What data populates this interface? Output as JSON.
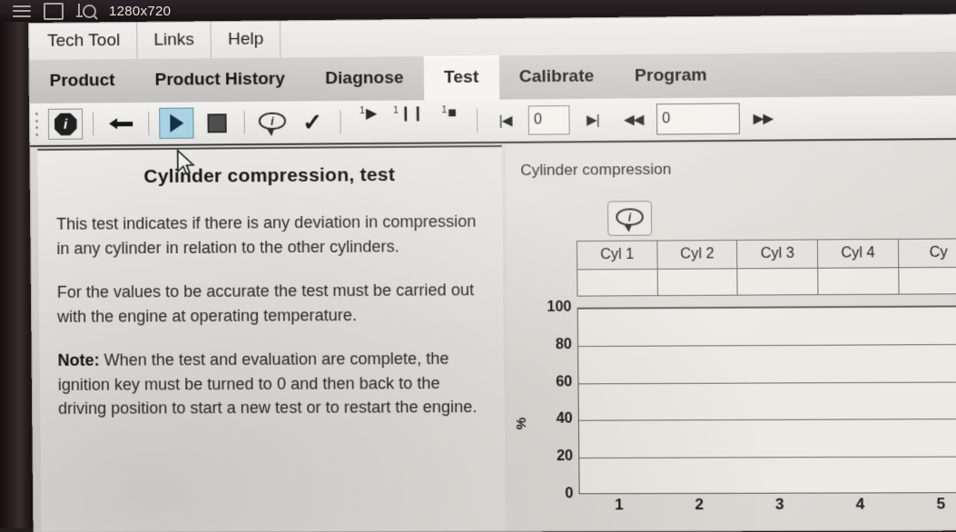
{
  "window": {
    "resolution": "1280x720",
    "icons": [
      "hamburger-menu-icon",
      "window-square-icon",
      "measure-magnifier-icon"
    ]
  },
  "menubar": {
    "items": [
      {
        "label": "Tech Tool"
      },
      {
        "label": "Links"
      },
      {
        "label": "Help"
      }
    ]
  },
  "tabs": [
    {
      "label": "Product",
      "active": false
    },
    {
      "label": "Product History",
      "active": false
    },
    {
      "label": "Diagnose",
      "active": false
    },
    {
      "label": "Test",
      "active": true
    },
    {
      "label": "Calibrate",
      "active": false
    },
    {
      "label": "Program",
      "active": false
    }
  ],
  "toolbar": {
    "info_button": "i",
    "back_button": "back-arrow",
    "play_button": "play",
    "stop_button": "stop",
    "info_balloon_button": "i",
    "confirm_button": "✓",
    "step_play": {
      "sup": "1",
      "glyph": "▶"
    },
    "step_pause": {
      "sup": "1",
      "glyph": "❙❙"
    },
    "step_stop": {
      "sup": "1",
      "glyph": "■"
    },
    "first_button": "|◀",
    "page_input_value": "0",
    "next_button": "▶|",
    "rewind_button": "◀◀",
    "position_input_value": "0",
    "forward_button": "▶▶"
  },
  "document": {
    "title": "Cylinder compression, test",
    "paragraphs": [
      "This test indicates if there is any deviation in compression in any cylinder in relation to the other cylinders.",
      "For the values to be accurate the test must be carried out with the engine at operating temperature."
    ],
    "note_label": "Note:",
    "note_text": " When the test and evaluation are complete, the ignition key must be turned to 0 and then back to the driving position to start a new test or to restart the engine."
  },
  "chart_data": {
    "type": "bar",
    "title": "Cylinder compression",
    "xlabel": "",
    "ylabel": "%",
    "categories": [
      "1",
      "2",
      "3",
      "4",
      "5"
    ],
    "values": [],
    "series": [],
    "ylim": [
      0,
      100
    ],
    "yticks": [
      0,
      20,
      40,
      60,
      80,
      100
    ],
    "xticks": [
      "1",
      "2",
      "3",
      "4",
      "5"
    ],
    "grid": true,
    "legend": "none",
    "table": {
      "headers": [
        "Cyl 1",
        "Cyl 2",
        "Cyl 3",
        "Cyl 4",
        "Cy"
      ],
      "rows": [
        [
          "",
          "",
          "",
          "",
          ""
        ]
      ]
    }
  },
  "colors": {
    "accent": "#a9d3e2",
    "tab_active_bg": "#f4f3f1",
    "window_bg": "#d8d6d2",
    "text": "#1e1e1e"
  }
}
